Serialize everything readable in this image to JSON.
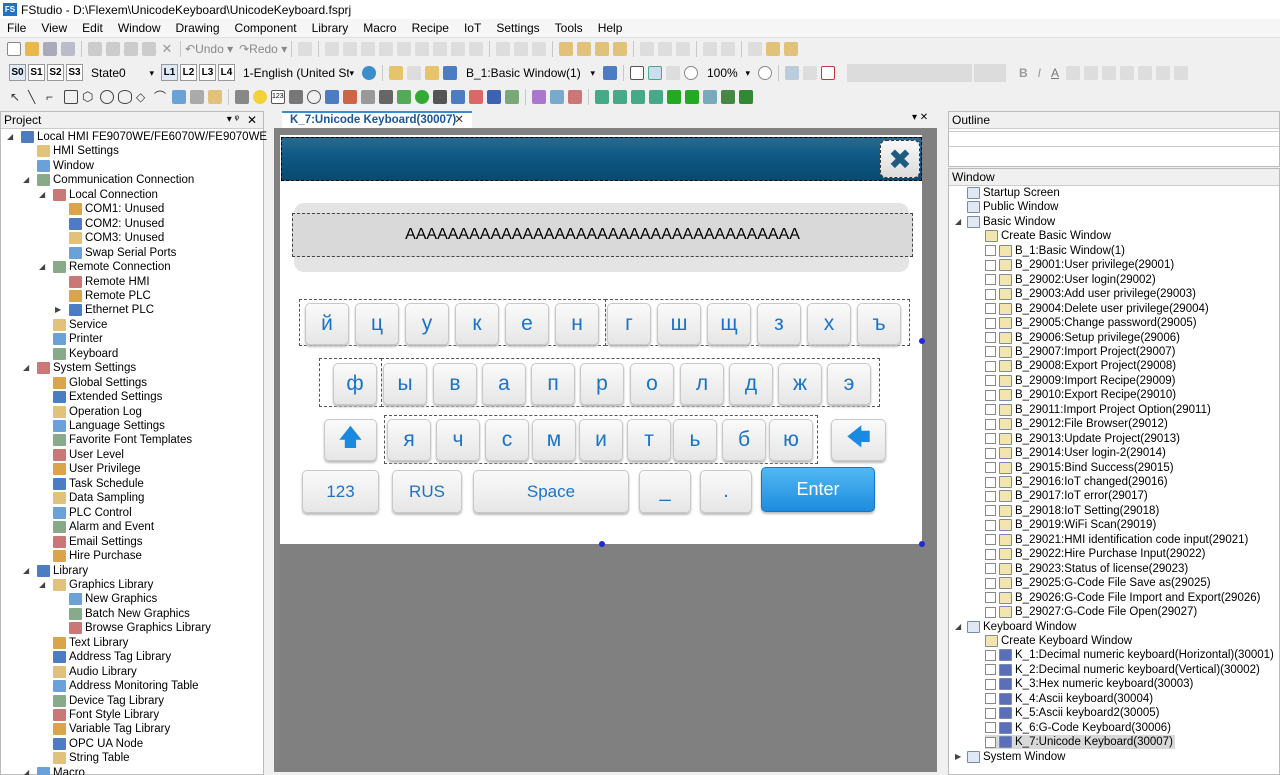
{
  "app": {
    "title": "FStudio - D:\\Flexem\\UnicodeKeyboard\\UnicodeKeyboard.fsprj",
    "icon_text": "FS"
  },
  "menu": [
    "File",
    "View",
    "Edit",
    "Window",
    "Drawing",
    "Component",
    "Library",
    "Macro",
    "Recipe",
    "IoT",
    "Settings",
    "Tools",
    "Help"
  ],
  "toolbar": {
    "undo": "Undo",
    "redo": "Redo",
    "state": "State0",
    "language": "1-English (United St",
    "window_select": "B_1:Basic Window(1)",
    "zoom": "100%",
    "state_btns": [
      "S0",
      "S1",
      "S2",
      "S3"
    ],
    "layer_btns": [
      "L1",
      "L2",
      "L3",
      "L4"
    ]
  },
  "project": {
    "header": "Project",
    "items": [
      {
        "label": "Local HMI FE9070WE/FE6070W/FE9070WE",
        "lvl": 0,
        "arrow": "open"
      },
      {
        "label": "HMI Settings",
        "lvl": 1
      },
      {
        "label": "Window",
        "lvl": 1
      },
      {
        "label": "Communication Connection",
        "lvl": 1,
        "arrow": "open"
      },
      {
        "label": "Local Connection",
        "lvl": 2,
        "arrow": "open"
      },
      {
        "label": "COM1: Unused",
        "lvl": 3
      },
      {
        "label": "COM2: Unused",
        "lvl": 3
      },
      {
        "label": "COM3: Unused",
        "lvl": 3
      },
      {
        "label": "Swap Serial Ports",
        "lvl": 3
      },
      {
        "label": "Remote Connection",
        "lvl": 2,
        "arrow": "open"
      },
      {
        "label": "Remote HMI",
        "lvl": 3
      },
      {
        "label": "Remote PLC",
        "lvl": 3
      },
      {
        "label": "Ethernet PLC",
        "lvl": 3,
        "arrow": "closed"
      },
      {
        "label": "Service",
        "lvl": 2
      },
      {
        "label": "Printer",
        "lvl": 2
      },
      {
        "label": "Keyboard",
        "lvl": 2
      },
      {
        "label": "System Settings",
        "lvl": 1,
        "arrow": "open"
      },
      {
        "label": "Global Settings",
        "lvl": 2
      },
      {
        "label": "Extended Settings",
        "lvl": 2
      },
      {
        "label": "Operation Log",
        "lvl": 2
      },
      {
        "label": "Language Settings",
        "lvl": 2
      },
      {
        "label": "Favorite Font Templates",
        "lvl": 2
      },
      {
        "label": "User Level",
        "lvl": 2
      },
      {
        "label": "User Privilege",
        "lvl": 2
      },
      {
        "label": "Task Schedule",
        "lvl": 2
      },
      {
        "label": "Data Sampling",
        "lvl": 2
      },
      {
        "label": "PLC Control",
        "lvl": 2
      },
      {
        "label": "Alarm and Event",
        "lvl": 2
      },
      {
        "label": "Email Settings",
        "lvl": 2
      },
      {
        "label": "Hire Purchase",
        "lvl": 2
      },
      {
        "label": "Library",
        "lvl": 1,
        "arrow": "open"
      },
      {
        "label": "Graphics Library",
        "lvl": 2,
        "arrow": "open"
      },
      {
        "label": "New Graphics",
        "lvl": 3
      },
      {
        "label": "Batch New Graphics",
        "lvl": 3
      },
      {
        "label": "Browse Graphics Library",
        "lvl": 3
      },
      {
        "label": "Text Library",
        "lvl": 2
      },
      {
        "label": "Address Tag Library",
        "lvl": 2
      },
      {
        "label": "Audio Library",
        "lvl": 2
      },
      {
        "label": "Address Monitoring Table",
        "lvl": 2
      },
      {
        "label": "Device Tag Library",
        "lvl": 2
      },
      {
        "label": "Font Style Library",
        "lvl": 2
      },
      {
        "label": "Variable Tag Library",
        "lvl": 2
      },
      {
        "label": "OPC UA Node",
        "lvl": 2
      },
      {
        "label": "String Table",
        "lvl": 2
      },
      {
        "label": "Macro",
        "lvl": 1,
        "arrow": "open"
      }
    ]
  },
  "editor": {
    "tab_label": "K_7:Unicode Keyboard(30007)",
    "input_text": "AAAAAAAAAAAAAAAAAAAAAAAAAAAAAAAAAAAAA",
    "row1": [
      "й",
      "ц",
      "у",
      "к",
      "е",
      "н",
      "г",
      "ш",
      "щ",
      "з",
      "х",
      "ъ"
    ],
    "row2": [
      "ф",
      "ы",
      "в",
      "а",
      "п",
      "р",
      "о",
      "л",
      "д",
      "ж",
      "э"
    ],
    "row3": [
      "я",
      "ч",
      "с",
      "м",
      "и",
      "т",
      "ь",
      "б",
      "ю"
    ],
    "key_123": "123",
    "key_rus": "RUS",
    "key_space": "Space",
    "key_underscore": "_",
    "key_dot": ".",
    "key_enter": "Enter"
  },
  "outline": {
    "header": "Outline"
  },
  "window_panel": {
    "header": "Window",
    "items": [
      {
        "label": "Startup Screen",
        "lvl": 0
      },
      {
        "label": "Public Window",
        "lvl": 0
      },
      {
        "label": "Basic Window",
        "lvl": 0,
        "arrow": "open"
      },
      {
        "label": "Create Basic Window",
        "lvl": 1
      },
      {
        "label": "B_1:Basic Window(1)",
        "lvl": 1,
        "chk": true
      },
      {
        "label": "B_29001:User privilege(29001)",
        "lvl": 1,
        "chk": true
      },
      {
        "label": "B_29002:User login(29002)",
        "lvl": 1,
        "chk": true
      },
      {
        "label": "B_29003:Add user privilege(29003)",
        "lvl": 1,
        "chk": true
      },
      {
        "label": "B_29004:Delete user privilege(29004)",
        "lvl": 1,
        "chk": true
      },
      {
        "label": "B_29005:Change password(29005)",
        "lvl": 1,
        "chk": true
      },
      {
        "label": "B_29006:Setup privilege(29006)",
        "lvl": 1,
        "chk": true
      },
      {
        "label": "B_29007:Import Project(29007)",
        "lvl": 1,
        "chk": true
      },
      {
        "label": "B_29008:Export Project(29008)",
        "lvl": 1,
        "chk": true
      },
      {
        "label": "B_29009:Import Recipe(29009)",
        "lvl": 1,
        "chk": true
      },
      {
        "label": "B_29010:Export Recipe(29010)",
        "lvl": 1,
        "chk": true
      },
      {
        "label": "B_29011:Import Project Option(29011)",
        "lvl": 1,
        "chk": true
      },
      {
        "label": "B_29012:File Browser(29012)",
        "lvl": 1,
        "chk": true
      },
      {
        "label": "B_29013:Update Project(29013)",
        "lvl": 1,
        "chk": true
      },
      {
        "label": "B_29014:User login-2(29014)",
        "lvl": 1,
        "chk": true
      },
      {
        "label": "B_29015:Bind Success(29015)",
        "lvl": 1,
        "chk": true
      },
      {
        "label": "B_29016:IoT changed(29016)",
        "lvl": 1,
        "chk": true
      },
      {
        "label": "B_29017:IoT error(29017)",
        "lvl": 1,
        "chk": true
      },
      {
        "label": "B_29018:IoT Setting(29018)",
        "lvl": 1,
        "chk": true
      },
      {
        "label": "B_29019:WiFi Scan(29019)",
        "lvl": 1,
        "chk": true
      },
      {
        "label": "B_29021:HMI identification code input(29021)",
        "lvl": 1,
        "chk": true
      },
      {
        "label": "B_29022:Hire Purchase Input(29022)",
        "lvl": 1,
        "chk": true
      },
      {
        "label": "B_29023:Status of license(29023)",
        "lvl": 1,
        "chk": true
      },
      {
        "label": "B_29025:G-Code File Save as(29025)",
        "lvl": 1,
        "chk": true
      },
      {
        "label": "B_29026:G-Code File Import and Export(29026)",
        "lvl": 1,
        "chk": true
      },
      {
        "label": "B_29027:G-Code File Open(29027)",
        "lvl": 1,
        "chk": true
      },
      {
        "label": "Keyboard Window",
        "lvl": 0,
        "arrow": "open"
      },
      {
        "label": "Create Keyboard Window",
        "lvl": 1
      },
      {
        "label": "K_1:Decimal numeric keyboard(Horizontal)(30001)",
        "lvl": 1,
        "chk": true,
        "kb": true
      },
      {
        "label": "K_2:Decimal numeric keyboard(Vertical)(30002)",
        "lvl": 1,
        "chk": true,
        "kb": true
      },
      {
        "label": "K_3:Hex numeric keyboard(30003)",
        "lvl": 1,
        "chk": true,
        "kb": true
      },
      {
        "label": "K_4:Ascii keyboard(30004)",
        "lvl": 1,
        "chk": true,
        "kb": true
      },
      {
        "label": "K_5:Ascii keyboard2(30005)",
        "lvl": 1,
        "chk": true,
        "kb": true
      },
      {
        "label": "K_6:G-Code Keyboard(30006)",
        "lvl": 1,
        "chk": true,
        "kb": true
      },
      {
        "label": "K_7:Unicode Keyboard(30007)",
        "lvl": 1,
        "chk": true,
        "kb": true,
        "selected": true
      },
      {
        "label": "System Window",
        "lvl": 0,
        "arrow": "closed"
      }
    ]
  }
}
